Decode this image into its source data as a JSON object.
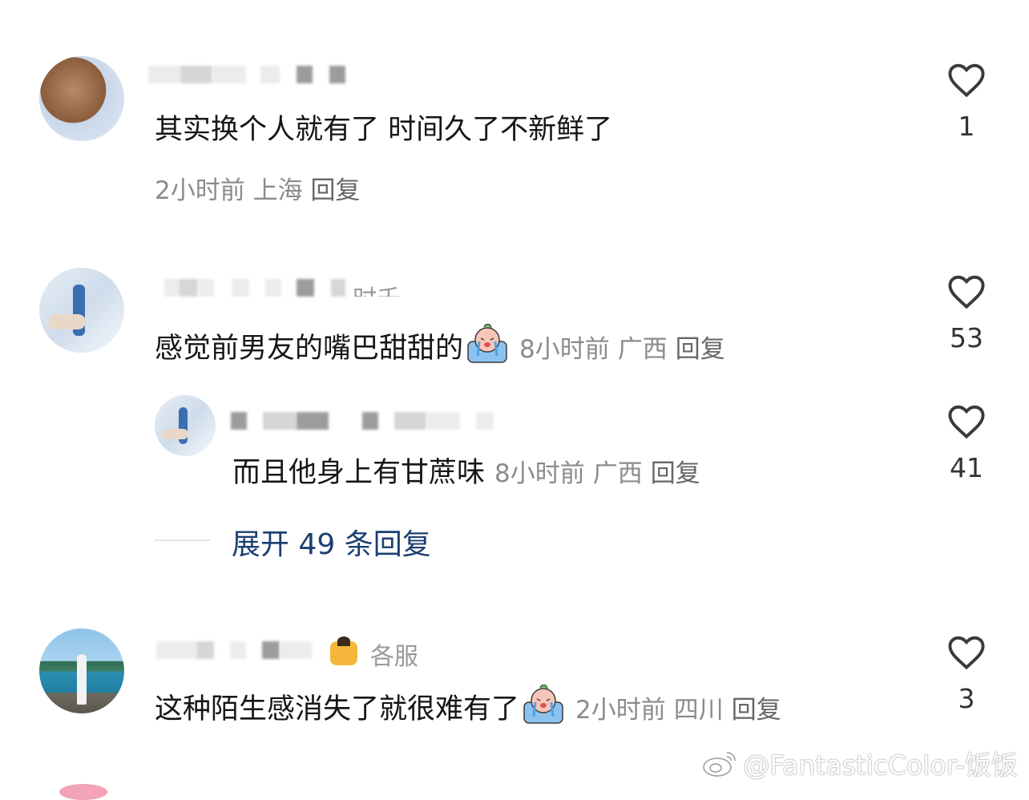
{
  "comments": [
    {
      "text": "其实换个人就有了 时间久了不新鲜了",
      "time": "2小时前",
      "location": "上海",
      "reply": "回复",
      "likes": "1",
      "avatar_icon": "monkey-avatar"
    },
    {
      "text": "感觉前男友的嘴巴甜甜的",
      "emoji": "crying-emoji",
      "time": "8小时前",
      "location": "广西",
      "reply": "回复",
      "likes": "53",
      "avatar_icon": "bottle-avatar",
      "name_tail": "时千",
      "sub_reply": {
        "text": "而且他身上有甘蔗味",
        "time": "8小时前",
        "location": "广西",
        "reply": "回复",
        "likes": "41",
        "avatar_icon": "bottle-avatar"
      },
      "expand_label": "展开 49 条回复"
    },
    {
      "text": "这种陌生感消失了就很难有了",
      "emoji": "crying-emoji",
      "time": "2小时前",
      "location": "四川",
      "reply": "回复",
      "likes": "3",
      "avatar_icon": "seaside-avatar",
      "name_tail": "各服"
    }
  ],
  "watermark": "@FantasticColor-饭饭",
  "icons": {
    "like": "heart-outline-icon",
    "weibo": "weibo-logo-icon"
  },
  "colors": {
    "link": "#1c3f72",
    "meta": "#8b8b8b",
    "text": "#161616"
  }
}
